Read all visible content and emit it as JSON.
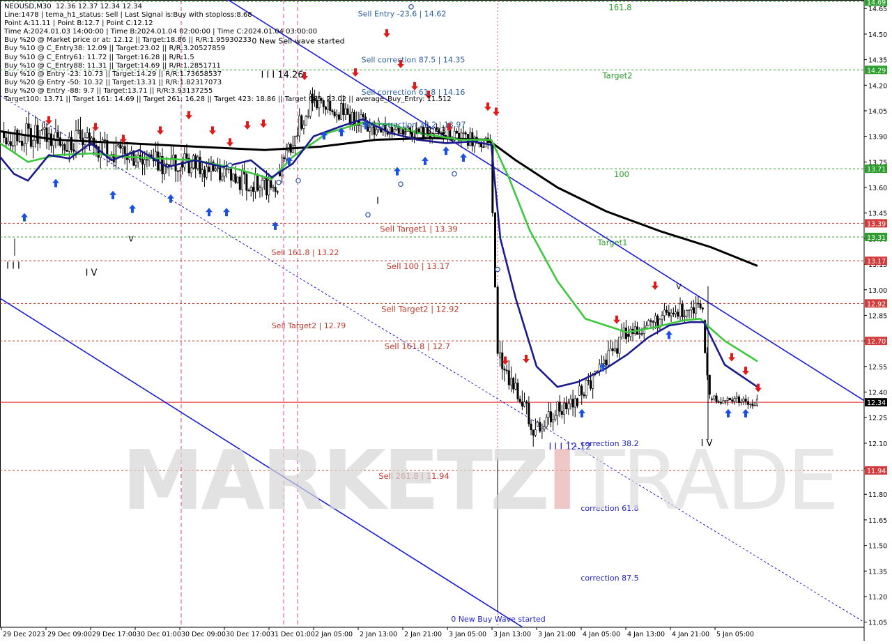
{
  "info_lines": [
    "NEOUSD,M30  12.36 12.37 12.34 12.34",
    "Line:1478 | tema_h1_status: Sell | Last Signal is:Buy with stoploss:8.68",
    "Point A:11.11 | Point B:12.7 | Point C:12.12",
    "Time A:2024.01.03 14:00:00 | Time B:2024.01.04 02:00:00 | Time C:2024.01.04 03:00:00",
    "Buy %20 @ Market price or at: 12.12 || Target:18.86 || R/R:1.95930233",
    "Buy %10 @ C_Entry38: 12.09 || Target:23.02 || R/R:3.20527859",
    "Buy %10 @ C_Entry61: 11.72 || Target:16.28 || R/R:1.5",
    "Buy %10 @ C_Entry88: 11.31 || Target:14.69 || R/R:1.2851711",
    "Buy %10 @ Entry -23: 10.73 || Target:14.29 || R/R:1.73658537",
    "Buy %20 @ Entry -50: 10.32 || Target:13.31 || R/R:1.82317073",
    "Buy %20 @ Entry -88: 9.7 || Target:13.71 || R/R:3.93137255",
    "Target100: 13.71 || Target 161: 14.69 || Target 261: 16.28 || Target 423: 18.86 || Target 685: 23.02 || average_Buy_Entry: 11.512"
  ],
  "watermark": {
    "part1": "MARKETZ",
    "part2": "I",
    "part3": "TRADE"
  },
  "chart_data": {
    "type": "candlestick",
    "symbol": "NEOUSD",
    "timeframe": "M30",
    "ylim": [
      11.02,
      14.7
    ],
    "y_ticks": [
      11.05,
      11.2,
      11.35,
      11.5,
      11.65,
      11.8,
      11.95,
      12.1,
      12.25,
      12.4,
      12.55,
      12.7,
      12.85,
      13.0,
      13.15,
      13.3,
      13.45,
      13.6,
      13.75,
      13.9,
      14.05,
      14.2,
      14.35,
      14.5,
      14.65
    ],
    "x_labels": [
      "29 Dec 2023",
      "29 Dec 09:00",
      "29 Dec 17:00",
      "30 Dec 01:00",
      "30 Dec 09:00",
      "30 Dec 17:00",
      "31 Dec 01:00",
      "2 Jan 05:00",
      "2 Jan 13:00",
      "2 Jan 21:00",
      "3 Jan 05:00",
      "3 Jan 13:00",
      "3 Jan 21:00",
      "4 Jan 05:00",
      "4 Jan 13:00",
      "4 Jan 21:00",
      "5 Jan 05:00"
    ],
    "current_price": 12.34,
    "price_tags": [
      {
        "value": 14.69,
        "label": "14.69",
        "color": "#2e9e2e"
      },
      {
        "value": 14.29,
        "label": "14.29",
        "color": "#2e9e2e"
      },
      {
        "value": 13.71,
        "label": "13.71",
        "color": "#2e9e2e"
      },
      {
        "value": 13.39,
        "label": "13.39",
        "color": "#d23c3c"
      },
      {
        "value": 13.31,
        "label": "13.31",
        "color": "#2e9e2e"
      },
      {
        "value": 13.17,
        "label": "13.17",
        "color": "#d23c3c"
      },
      {
        "value": 12.92,
        "label": "12.92",
        "color": "#d23c3c"
      },
      {
        "value": 12.7,
        "label": "12.70",
        "color": "#d23c3c"
      },
      {
        "value": 12.34,
        "label": "12.34",
        "color": "#000000"
      },
      {
        "value": 11.94,
        "label": "11.94",
        "color": "#d23c3c"
      }
    ],
    "levels": [
      {
        "value": 14.69,
        "color": "#2e9e2e",
        "label": "161.8",
        "label_x": 890,
        "label_color": "#2e9e2e"
      },
      {
        "value": 14.29,
        "color": "#2e9e2e",
        "label": "Target2",
        "label_x": 886,
        "label_color": "#2e9e2e"
      },
      {
        "value": 13.71,
        "color": "#2e9e2e",
        "label": "100",
        "label_x": 892,
        "label_color": "#2e9e2e"
      },
      {
        "value": 13.39,
        "color": "#c0392b",
        "label": "Sell Target1 | 13.39",
        "label_x": 601,
        "label_color": "#c0392b"
      },
      {
        "value": 13.31,
        "color": "#2e9e2e",
        "label": "Target1",
        "label_x": 879,
        "label_color": "#2e9e2e"
      },
      {
        "value": 13.17,
        "color": "#c0392b",
        "label": "Sell 100 | 13.17",
        "label_x": 600,
        "label_color": "#c0392b"
      },
      {
        "value": 12.92,
        "color": "#c0392b",
        "label": "Sell Target2 | 12.92",
        "label_x": 603,
        "label_color": "#c0392b"
      },
      {
        "value": 12.7,
        "color": "#c0392b",
        "label": "Sell 161.8 | 12.7",
        "label_x": 599,
        "label_color": "#c0392b"
      },
      {
        "value": 11.94,
        "color": "#c0392b",
        "label": "Sell 261.8 | 11.94",
        "label_x": 594,
        "label_color": "#c0392b"
      }
    ],
    "annotations": [
      {
        "text": "Sell Entry -23.6 | 14.62",
        "value": 14.62,
        "x": 577,
        "color": "#2b5fa0"
      },
      {
        "text": "Sell correction 87.5 | 14.35",
        "value": 14.35,
        "x": 593,
        "color": "#2b5fa0"
      },
      {
        "text": "Sell correction 61.8 | 14.16",
        "value": 14.16,
        "x": 593,
        "color": "#2b5fa0"
      },
      {
        "text": "Sell correction 38.2 | 13.97",
        "value": 13.97,
        "x": 594,
        "color": "#2b5fa0"
      },
      {
        "text": "Sell 161.8 | 13.22",
        "value": 13.22,
        "x": 438,
        "color": "#c0392b"
      },
      {
        "text": "Sell Target2 | 12.79",
        "value": 12.79,
        "x": 443,
        "color": "#c0392b"
      },
      {
        "text": "0 New Sell wave started",
        "value": 14.46,
        "x": 428,
        "color": "#000000"
      },
      {
        "text": "I I I 14.26",
        "value": 14.26,
        "x": 405,
        "color": "#000000"
      },
      {
        "text": "I I I 13.93",
        "value": 13.93,
        "x": 610,
        "color": "#000000"
      },
      {
        "text": "I V",
        "value": 13.1,
        "x": 131,
        "color": "#000000"
      },
      {
        "text": "V",
        "value": 13.3,
        "x": 188,
        "color": "#000000"
      },
      {
        "text": "I I I",
        "value": 13.14,
        "x": 19,
        "color": "#000000"
      },
      {
        "text": "I",
        "value": 13.52,
        "x": 542,
        "color": "#000000"
      },
      {
        "text": "correction 38.2",
        "value": 12.1,
        "x": 875,
        "color": "#2121c8"
      },
      {
        "text": "I I I 12.12",
        "value": 12.08,
        "x": 818,
        "color": "#2121c8"
      },
      {
        "text": "correction 61.8",
        "value": 11.72,
        "x": 875,
        "color": "#2121c8"
      },
      {
        "text": "correction 87.5",
        "value": 11.31,
        "x": 875,
        "color": "#2121c8"
      },
      {
        "text": "0 New Buy Wave started",
        "value": 11.07,
        "x": 715,
        "color": "#2121c8"
      },
      {
        "text": "I V",
        "value": 12.1,
        "x": 1014,
        "color": "#000000"
      },
      {
        "text": "V",
        "value": 13.02,
        "x": 974,
        "color": "#000000"
      }
    ],
    "series": [
      {
        "name": "",
        "color": "#000000",
        "points": [
          [
            0,
            13.93
          ],
          [
            80,
            13.88
          ],
          [
            180,
            13.86
          ],
          [
            280,
            13.84
          ],
          [
            380,
            13.82
          ],
          [
            460,
            13.84
          ],
          [
            540,
            13.88
          ],
          [
            620,
            13.89
          ],
          [
            700,
            13.88
          ],
          [
            740,
            13.76
          ],
          [
            800,
            13.6
          ],
          [
            870,
            13.46
          ],
          [
            950,
            13.34
          ],
          [
            1020,
            13.25
          ],
          [
            1087,
            13.14
          ]
        ]
      },
      {
        "name": "",
        "color": "#3cc83c",
        "points": [
          [
            0,
            13.86
          ],
          [
            40,
            13.75
          ],
          [
            80,
            13.79
          ],
          [
            130,
            13.8
          ],
          [
            180,
            13.78
          ],
          [
            230,
            13.77
          ],
          [
            280,
            13.76
          ],
          [
            330,
            13.72
          ],
          [
            390,
            13.65
          ],
          [
            420,
            13.78
          ],
          [
            470,
            13.92
          ],
          [
            520,
            13.98
          ],
          [
            560,
            13.97
          ],
          [
            600,
            13.92
          ],
          [
            660,
            13.88
          ],
          [
            705,
            13.88
          ],
          [
            730,
            13.66
          ],
          [
            760,
            13.35
          ],
          [
            800,
            13.05
          ],
          [
            840,
            12.83
          ],
          [
            870,
            12.79
          ],
          [
            900,
            12.75
          ],
          [
            940,
            12.78
          ],
          [
            980,
            12.82
          ],
          [
            1005,
            12.83
          ],
          [
            1015,
            12.79
          ],
          [
            1040,
            12.7
          ],
          [
            1087,
            12.58
          ]
        ]
      },
      {
        "name": "",
        "color": "#1a1a8c",
        "points": [
          [
            0,
            13.78
          ],
          [
            20,
            13.68
          ],
          [
            40,
            13.64
          ],
          [
            70,
            13.79
          ],
          [
            100,
            13.77
          ],
          [
            130,
            13.86
          ],
          [
            160,
            13.76
          ],
          [
            200,
            13.82
          ],
          [
            240,
            13.72
          ],
          [
            280,
            13.76
          ],
          [
            320,
            13.72
          ],
          [
            360,
            13.76
          ],
          [
            390,
            13.66
          ],
          [
            420,
            13.74
          ],
          [
            450,
            13.9
          ],
          [
            490,
            13.96
          ],
          [
            520,
            14.0
          ],
          [
            560,
            13.92
          ],
          [
            600,
            13.88
          ],
          [
            640,
            13.86
          ],
          [
            680,
            13.87
          ],
          [
            705,
            13.85
          ],
          [
            718,
            13.3
          ],
          [
            740,
            12.95
          ],
          [
            770,
            12.55
          ],
          [
            800,
            12.43
          ],
          [
            830,
            12.46
          ],
          [
            870,
            12.54
          ],
          [
            900,
            12.62
          ],
          [
            930,
            12.72
          ],
          [
            960,
            12.79
          ],
          [
            990,
            12.81
          ],
          [
            1010,
            12.81
          ],
          [
            1040,
            12.56
          ],
          [
            1087,
            12.43
          ]
        ]
      }
    ],
    "candles": {
      "segments": [
        {
          "x0": 4,
          "x1": 130,
          "p0": 13.92,
          "p1": 13.85,
          "vol": 0.13,
          "seed": 3
        },
        {
          "x0": 130,
          "x1": 260,
          "p0": 13.85,
          "p1": 13.72,
          "vol": 0.12,
          "seed": 7
        },
        {
          "x0": 260,
          "x1": 400,
          "p0": 13.75,
          "p1": 13.58,
          "vol": 0.1,
          "seed": 11
        },
        {
          "x0": 400,
          "x1": 450,
          "p0": 13.7,
          "p1": 14.12,
          "vol": 0.1,
          "seed": 13
        },
        {
          "x0": 450,
          "x1": 545,
          "p0": 14.12,
          "p1": 13.95,
          "vol": 0.09,
          "seed": 17
        },
        {
          "x0": 545,
          "x1": 705,
          "p0": 13.95,
          "p1": 13.87,
          "vol": 0.07,
          "seed": 19
        },
        {
          "x0": 705,
          "x1": 716,
          "p0": 13.85,
          "p1": 12.62,
          "vol": 0.05,
          "seed": 23
        },
        {
          "x0": 716,
          "x1": 770,
          "p0": 12.6,
          "p1": 12.18,
          "vol": 0.12,
          "seed": 29
        },
        {
          "x0": 770,
          "x1": 830,
          "p0": 12.2,
          "p1": 12.36,
          "vol": 0.1,
          "seed": 31
        },
        {
          "x0": 830,
          "x1": 900,
          "p0": 12.38,
          "p1": 12.74,
          "vol": 0.1,
          "seed": 37
        },
        {
          "x0": 900,
          "x1": 1010,
          "p0": 12.74,
          "p1": 12.93,
          "vol": 0.08,
          "seed": 41
        },
        {
          "x0": 1010,
          "x1": 1020,
          "p0": 12.82,
          "p1": 12.35,
          "vol": 0.06,
          "seed": 43
        },
        {
          "x0": 1020,
          "x1": 1088,
          "p0": 12.36,
          "p1": 12.34,
          "vol": 0.05,
          "seed": 47
        }
      ],
      "spikes": [
        {
          "x": 714,
          "low": 11.11
        },
        {
          "x": 1016,
          "low": 12.12
        },
        {
          "x": 21,
          "low": 13.2
        }
      ]
    },
    "signals": {
      "sell": [
        [
          70,
          13.99
        ],
        [
          137,
          13.95
        ],
        [
          177,
          13.88
        ],
        [
          230,
          13.93
        ],
        [
          271,
          14.02
        ],
        [
          305,
          13.93
        ],
        [
          330,
          13.86
        ],
        [
          355,
          13.96
        ],
        [
          378,
          13.97
        ],
        [
          437,
          14.25
        ],
        [
          510,
          14.27
        ],
        [
          555,
          14.5
        ],
        [
          575,
          14.32
        ],
        [
          595,
          14.19
        ],
        [
          615,
          14.14
        ],
        [
          645,
          13.95
        ],
        [
          700,
          14.07
        ],
        [
          712,
          14.04
        ],
        [
          725,
          12.58
        ],
        [
          755,
          12.59
        ],
        [
          885,
          12.82
        ],
        [
          940,
          13.02
        ],
        [
          1050,
          12.6
        ],
        [
          1070,
          12.52
        ],
        [
          1088,
          12.42
        ]
      ],
      "buy": [
        [
          35,
          13.43
        ],
        [
          80,
          13.63
        ],
        [
          162,
          13.56
        ],
        [
          190,
          13.48
        ],
        [
          245,
          13.54
        ],
        [
          300,
          13.46
        ],
        [
          325,
          13.46
        ],
        [
          395,
          13.38
        ],
        [
          415,
          13.76
        ],
        [
          465,
          13.91
        ],
        [
          490,
          13.93
        ],
        [
          525,
          13.97
        ],
        [
          570,
          13.7
        ],
        [
          610,
          13.76
        ],
        [
          640,
          13.82
        ],
        [
          665,
          13.78
        ],
        [
          835,
          12.28
        ],
        [
          865,
          12.55
        ],
        [
          960,
          12.74
        ],
        [
          1045,
          12.28
        ],
        [
          1070,
          12.28
        ]
      ],
      "target_circles": [
        [
          590,
          14.66
        ],
        [
          575,
          13.62
        ],
        [
          528,
          13.44
        ],
        [
          652,
          13.68
        ],
        [
          714,
          13.12
        ],
        [
          330,
          13.73
        ],
        [
          400,
          13.63
        ],
        [
          428,
          13.64
        ]
      ]
    },
    "channels": [
      {
        "style": "solid",
        "color": "#1b1bd6",
        "p1": [
          320,
          14.72
        ],
        "p2": [
          1240,
          12.35
        ]
      },
      {
        "style": "solid",
        "color": "#1b1bd6",
        "p1": [
          0,
          12.95
        ],
        "p2": [
          750,
          11.02
        ]
      },
      {
        "style": "dashed",
        "color": "#1b1bd6",
        "p1": [
          0,
          14.14
        ],
        "p2": [
          1240,
          11.05
        ]
      }
    ],
    "vertical_lines": [
      {
        "x": 260,
        "color": "#d24a9a",
        "dash": "6,4"
      },
      {
        "x": 407,
        "color": "#d24a9a",
        "dash": "6,4"
      },
      {
        "x": 427,
        "color": "#d24a9a",
        "dash": "6,4"
      },
      {
        "x": 714,
        "color": "#d24a9a",
        "dash": "2,3"
      }
    ]
  }
}
